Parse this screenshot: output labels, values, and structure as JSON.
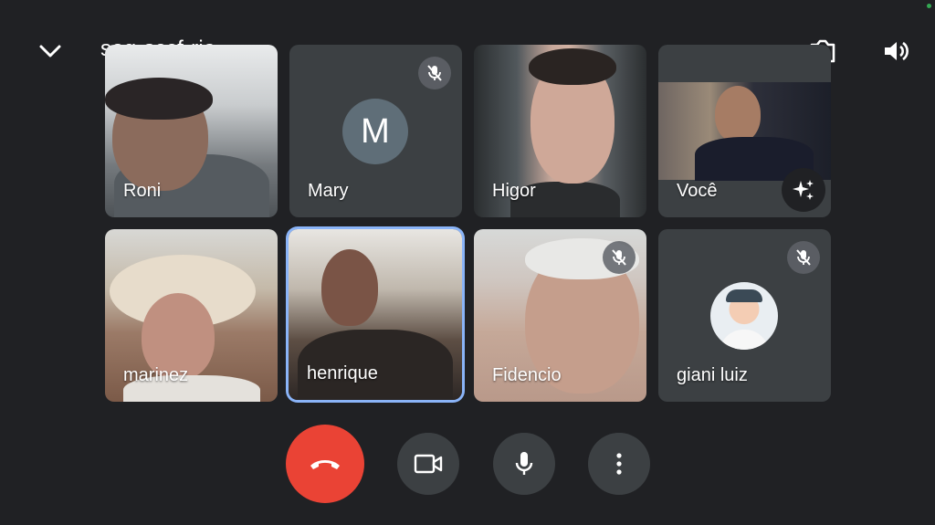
{
  "header": {
    "meeting_code": "seg-sccf-rja"
  },
  "participants": [
    {
      "name": "Roni",
      "muted": false
    },
    {
      "name": "Mary",
      "muted": true,
      "avatar_letter": "M"
    },
    {
      "name": "Higor",
      "muted": false
    },
    {
      "name": "Você",
      "muted": false
    },
    {
      "name": "marinez",
      "muted": false
    },
    {
      "name": "henrique",
      "muted": false,
      "active_speaker": true
    },
    {
      "name": "Fidencio",
      "muted": true
    },
    {
      "name": "giani luiz",
      "muted": true
    }
  ],
  "controls": {
    "end_call_color": "#ea4335",
    "active_speaker_color": "#8ab4f8",
    "icons": [
      "chevron-down-icon",
      "switch-camera-icon",
      "volume-icon",
      "end-call-icon",
      "camera-icon",
      "mic-icon",
      "more-vert-icon",
      "mic-off-icon",
      "sparkle-icon"
    ]
  }
}
